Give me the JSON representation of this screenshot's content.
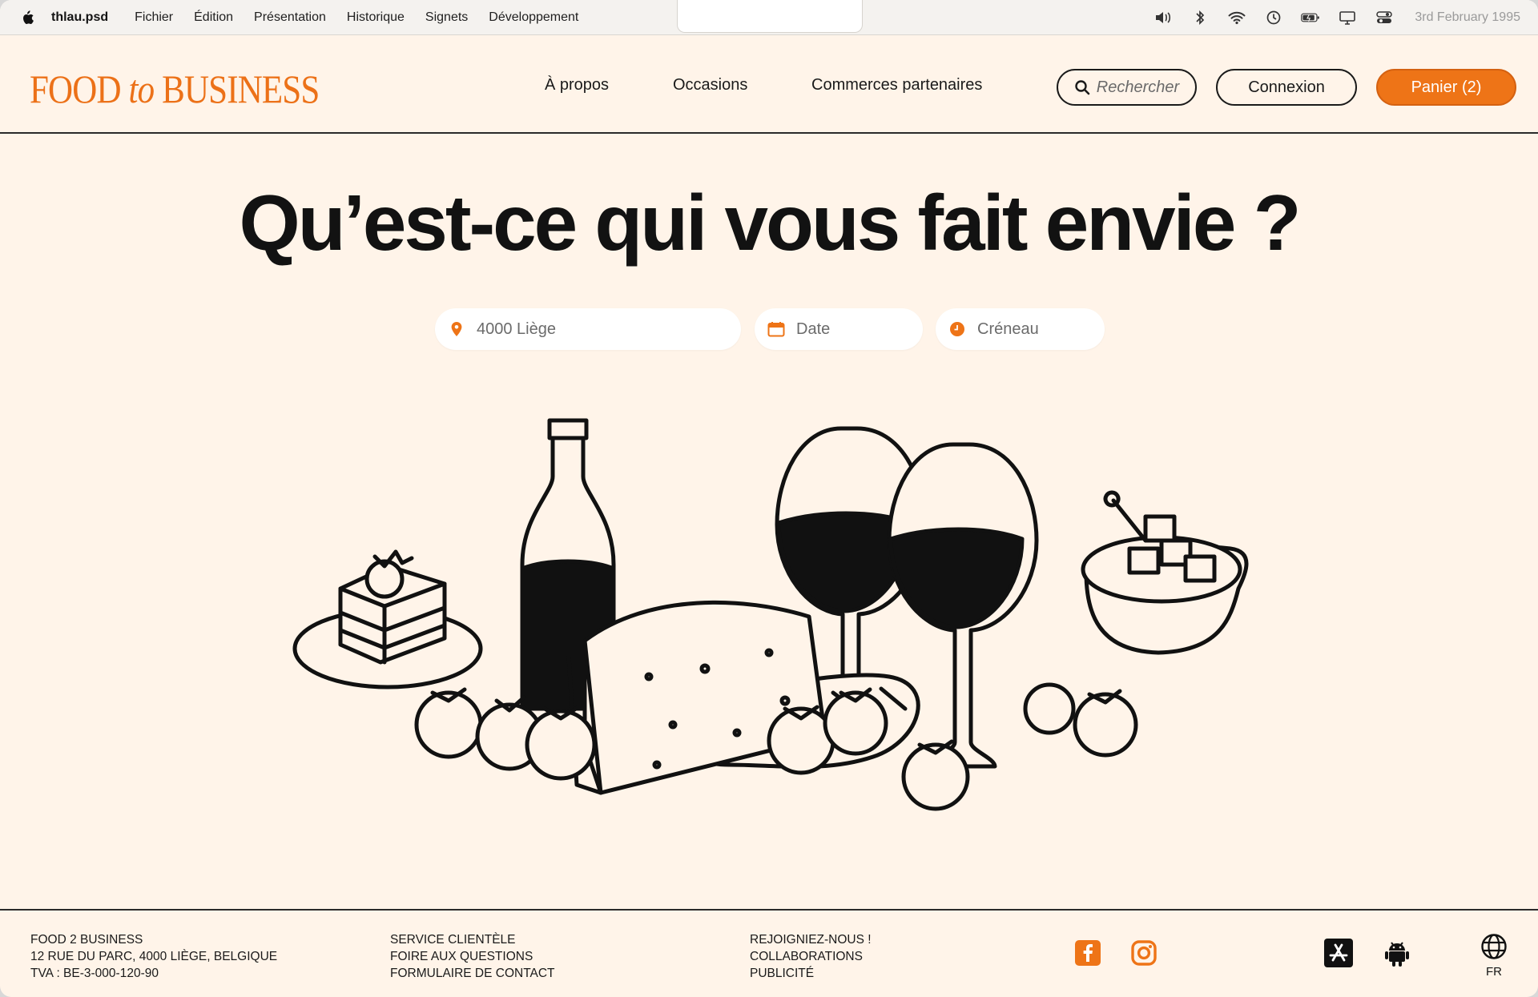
{
  "menubar": {
    "app_name": "thlau.psd",
    "items": [
      "Fichier",
      "Édition",
      "Présentation",
      "Historique",
      "Signets",
      "Développement"
    ],
    "date": "3rd February 1995",
    "status_icons": [
      "volume-icon",
      "bluetooth-icon",
      "wifi-icon",
      "time-machine-icon",
      "battery-icon",
      "display-icon",
      "control-center-icon"
    ]
  },
  "header": {
    "logo": {
      "part1": "FOOD",
      "part2": "to",
      "part3": "BUSINESS"
    },
    "nav": [
      "À propos",
      "Occasions",
      "Commerces partenaires"
    ],
    "search_label": "Rechercher",
    "login_label": "Connexion",
    "cart_label": "Panier (2)"
  },
  "hero": {
    "title": "Qu’est-ce qui vous fait envie ?",
    "location_placeholder": "4000 Liège",
    "date_placeholder": "Date",
    "slot_placeholder": "Créneau"
  },
  "footer": {
    "col1": [
      "FOOD 2 BUSINESS",
      "12 RUE DU PARC, 4000 LIÈGE, BELGIQUE",
      "TVA : BE-3-000-120-90"
    ],
    "col2": [
      "SERVICE CLIENTÈLE",
      "FOIRE AUX QUESTIONS",
      "FORMULAIRE DE CONTACT"
    ],
    "col3": [
      "REJOIGNIEZ-NOUS !",
      "COLLABORATIONS",
      "PUBLICITÉ"
    ],
    "language": "FR"
  },
  "colors": {
    "accent": "#ee7417",
    "background": "#fff4e9",
    "text": "#121212"
  }
}
